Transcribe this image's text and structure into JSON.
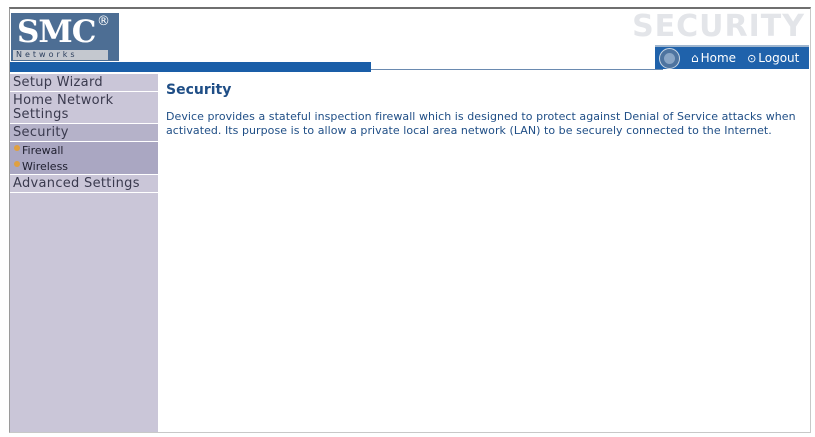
{
  "header": {
    "logo_brand": "SMC",
    "logo_reg": "®",
    "logo_sub": "Networks",
    "section_watermark": "SECURITY",
    "nav": {
      "home_label": "Home",
      "logout_label": "Logout"
    }
  },
  "sidebar": {
    "items": [
      {
        "label": "Setup Wizard"
      },
      {
        "label": "Home Network Settings"
      },
      {
        "label": "Security"
      },
      {
        "label": "Advanced Settings"
      }
    ],
    "security_subitems": [
      {
        "label": "Firewall"
      },
      {
        "label": "Wireless"
      }
    ]
  },
  "main": {
    "title": "Security",
    "description": "Device provides a stateful inspection firewall which is designed to protect against Denial of Service attacks when activated. Its purpose is to allow a private local area network (LAN) to be securely connected to the Internet."
  },
  "colors": {
    "brand_blue": "#1a5ea8",
    "text_blue": "#1f4e86",
    "sidebar_bg": "#cac6d8",
    "submenu_bg": "#aaa7c2",
    "bullet": "#e0a040"
  },
  "icons": [
    "help-icon",
    "home-icon",
    "logout-icon",
    "bullet-icon"
  ]
}
